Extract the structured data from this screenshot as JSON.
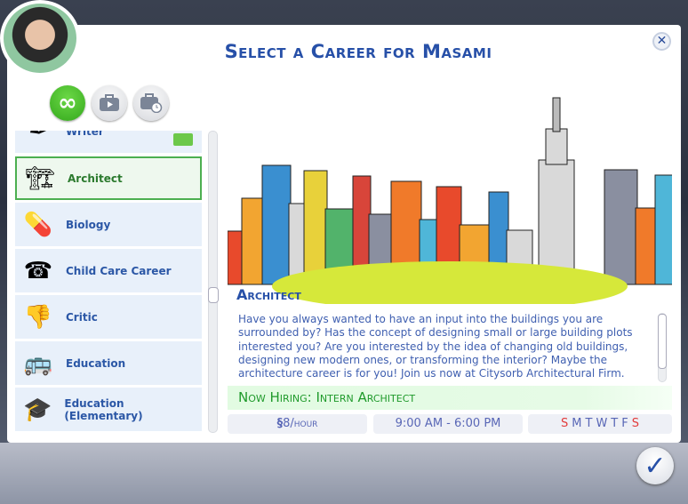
{
  "dialog": {
    "title": "Select a Career for Masami",
    "close_label": "✕",
    "confirm_label": "✓"
  },
  "tabs": [
    {
      "name": "all-careers",
      "icon": "infinity-icon",
      "active": true
    },
    {
      "name": "full-time",
      "icon": "briefcase-play-icon"
    },
    {
      "name": "part-time",
      "icon": "briefcase-clock-icon"
    }
  ],
  "careers": [
    {
      "label": "Writer",
      "icon": "quill-icon",
      "glyph": "✒"
    },
    {
      "label": "Architect",
      "icon": "building-crane-icon",
      "glyph": "🏗",
      "selected": true
    },
    {
      "label": "Biology",
      "icon": "capsule-icon",
      "glyph": "💊"
    },
    {
      "label": "Child Care Career",
      "icon": "telephone-bottle-icon",
      "glyph": "☎"
    },
    {
      "label": "Critic",
      "icon": "thumbs-down-icon",
      "glyph": "👎"
    },
    {
      "label": "Education",
      "icon": "school-bus-icon",
      "glyph": "🚌"
    },
    {
      "label": "Education (Elementary)",
      "icon": "graduation-cap-icon",
      "glyph": "🎓"
    }
  ],
  "detail": {
    "title": "Architect",
    "description": "Have you always wanted to have an input into the buildings you are surrounded by? Has the concept of designing small or large building plots interested you? Are you interested by the idea of changing old buildings, designing new modern ones, or transforming the interior? Maybe the architecture career is for you! Join us now at Citysorb Architectural Firm.",
    "hiring": "Now Hiring: Intern Architect",
    "pay_symbol": "§",
    "pay": "8/hour",
    "hours": "9:00  AM - 6:00  PM",
    "days": [
      {
        "d": "S",
        "off": true
      },
      {
        "d": "M"
      },
      {
        "d": "T"
      },
      {
        "d": "W"
      },
      {
        "d": "T"
      },
      {
        "d": "F"
      },
      {
        "d": "S",
        "off": true
      }
    ]
  },
  "colors": {
    "accent": "#2750a8",
    "hiring": "#1f9a2b",
    "day_off": "#e23b3b"
  }
}
